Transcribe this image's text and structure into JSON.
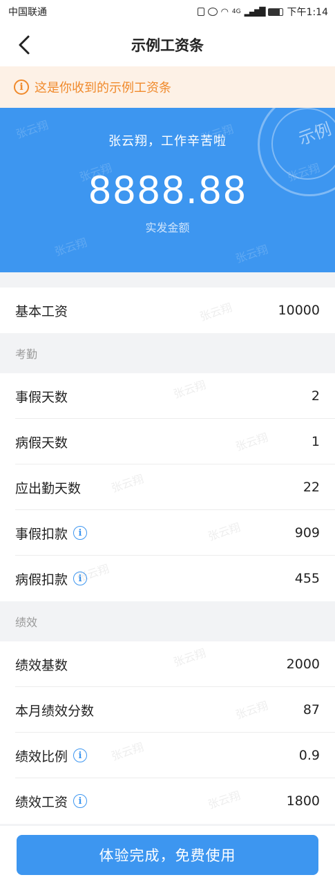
{
  "status_bar": {
    "carrier": "中国联通",
    "network": "4G",
    "time": "下午1:14"
  },
  "nav": {
    "title": "示例工资条",
    "back_icon": "chevron-left-icon"
  },
  "notice": {
    "icon": "info-icon",
    "text": "这是你收到的示例工资条"
  },
  "hero": {
    "greeting": "张云翔，工作辛苦啦",
    "amount": "8888.88",
    "amount_label": "实发金额",
    "stamp_text": "示例"
  },
  "watermark_text": "张云翔",
  "basic": {
    "label": "基本工资",
    "value": "10000"
  },
  "attendance": {
    "section_title": "考勤",
    "rows": [
      {
        "label": "事假天数",
        "value": "2",
        "info": false
      },
      {
        "label": "病假天数",
        "value": "1",
        "info": false
      },
      {
        "label": "应出勤天数",
        "value": "22",
        "info": false
      },
      {
        "label": "事假扣款",
        "value": "909",
        "info": true
      },
      {
        "label": "病假扣款",
        "value": "455",
        "info": true
      }
    ]
  },
  "performance": {
    "section_title": "绩效",
    "rows": [
      {
        "label": "绩效基数",
        "value": "2000",
        "info": false
      },
      {
        "label": "本月绩效分数",
        "value": "87",
        "info": false
      },
      {
        "label": "绩效比例",
        "value": "0.9",
        "info": true
      },
      {
        "label": "绩效工资",
        "value": "1800",
        "info": true
      }
    ]
  },
  "footer": {
    "cta_label": "体验完成，免费使用"
  },
  "colors": {
    "primary": "#3d96f0",
    "notice_bg": "#fdf1e6",
    "notice_text": "#f08a2c",
    "page_bg": "#f2f3f5"
  }
}
